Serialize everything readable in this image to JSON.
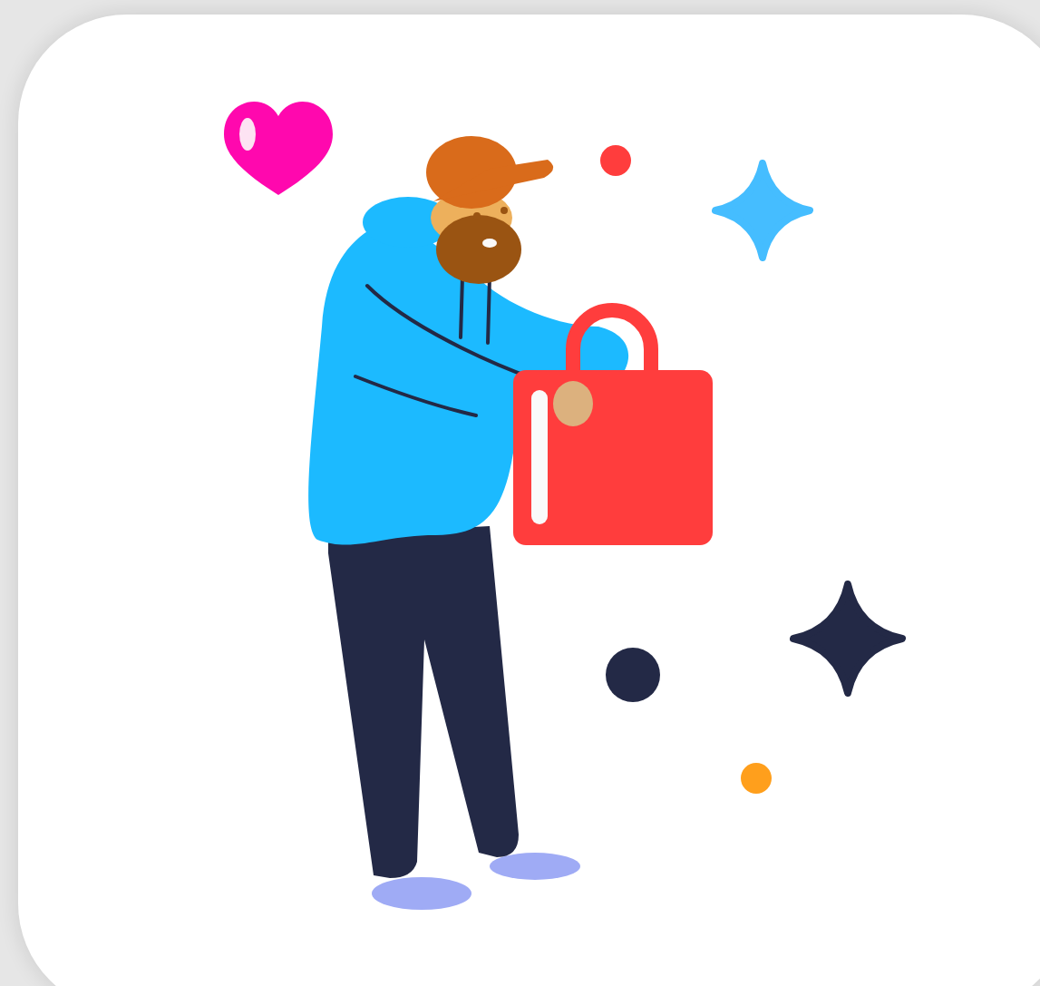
{
  "card": {
    "decorations": [
      {
        "kind": "heart",
        "color": "#ff08ae"
      },
      {
        "kind": "dot",
        "color": "#ff3d3d"
      },
      {
        "kind": "sparkle",
        "color": "#45bdff"
      },
      {
        "kind": "sparkle",
        "color": "#232946"
      },
      {
        "kind": "dot",
        "color": "#232946"
      },
      {
        "kind": "dot",
        "color": "#ff9f1c"
      }
    ]
  }
}
